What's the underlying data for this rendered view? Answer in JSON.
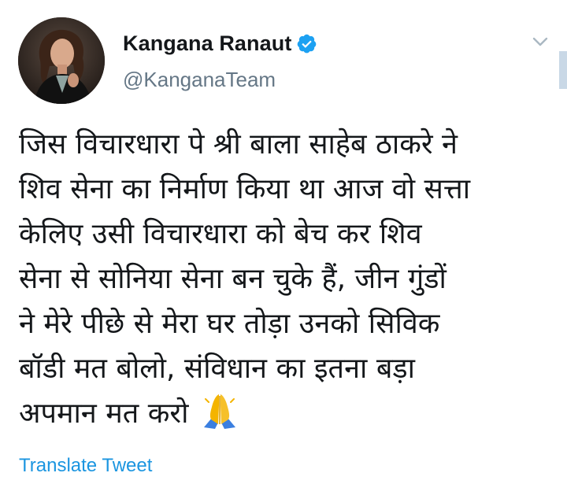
{
  "author": {
    "display_name": "Kangana Ranaut",
    "handle": "@KanganaTeam",
    "verified": true,
    "avatar_icon": "profile-photo"
  },
  "tweet": {
    "lines": [
      "जिस विचारधारा पे श्री बाला साहेब ठाकरे ने",
      "शिव सेना का निर्माण किया था आज वो सत्ता",
      "केलिए उसी विचारधारा को बेच कर शिव",
      "सेना से सोनिया सेना बन चुके हैं, जीन गुंडों",
      "ने मेरे पीछे से मेरा घर तोड़ा उनको सिविक",
      "बॉडी मत बोलो, संविधान का इतना बड़ा",
      "अपमान मत करो"
    ],
    "emoji": "folded-hands-emoji"
  },
  "actions": {
    "translate_label": "Translate Tweet",
    "menu_icon": "chevron-down-icon"
  },
  "colors": {
    "text": "#14171a",
    "secondary": "#657786",
    "link": "#1b95e0",
    "verified": "#1da1f2"
  }
}
